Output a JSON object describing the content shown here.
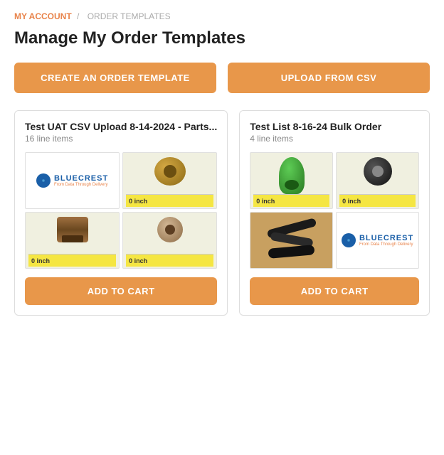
{
  "breadcrumb": {
    "account_label": "MY ACCOUNT",
    "separator": "/",
    "current": "ORDER TEMPLATES"
  },
  "page": {
    "title": "Manage My Order Templates"
  },
  "toolbar": {
    "create_label": "CREATE AN ORDER TEMPLATE",
    "upload_label": "UPLOAD FROM CSV"
  },
  "templates": [
    {
      "id": "template-1",
      "name": "Test UAT CSV Upload 8-14-2024 - Parts...",
      "line_items": "16 line items",
      "add_to_cart_label": "ADD TO CART",
      "images": [
        {
          "type": "bluecrest-logo",
          "alt": "BlueCrest logo"
        },
        {
          "type": "gold-bushing-ruler",
          "alt": "Gold bushing with ruler showing 0 inch"
        },
        {
          "type": "brown-bushing-ruler",
          "alt": "Brown bushing with ruler showing 0 inch"
        },
        {
          "type": "tan-bushing-ruler",
          "alt": "Tan bushing with ruler showing 0 inch"
        }
      ]
    },
    {
      "id": "template-2",
      "name": "Test List 8-16-24 Bulk Order",
      "line_items": "4 line items",
      "add_to_cart_label": "ADD TO CART",
      "images": [
        {
          "type": "green-plug-ruler",
          "alt": "Green plug with ruler showing 0 inch"
        },
        {
          "type": "black-ring-ruler",
          "alt": "Black ring with ruler showing 0 inch"
        },
        {
          "type": "black-seals-wood",
          "alt": "Black seals on wood surface"
        },
        {
          "type": "bluecrest-logo",
          "alt": "BlueCrest logo"
        }
      ]
    }
  ]
}
